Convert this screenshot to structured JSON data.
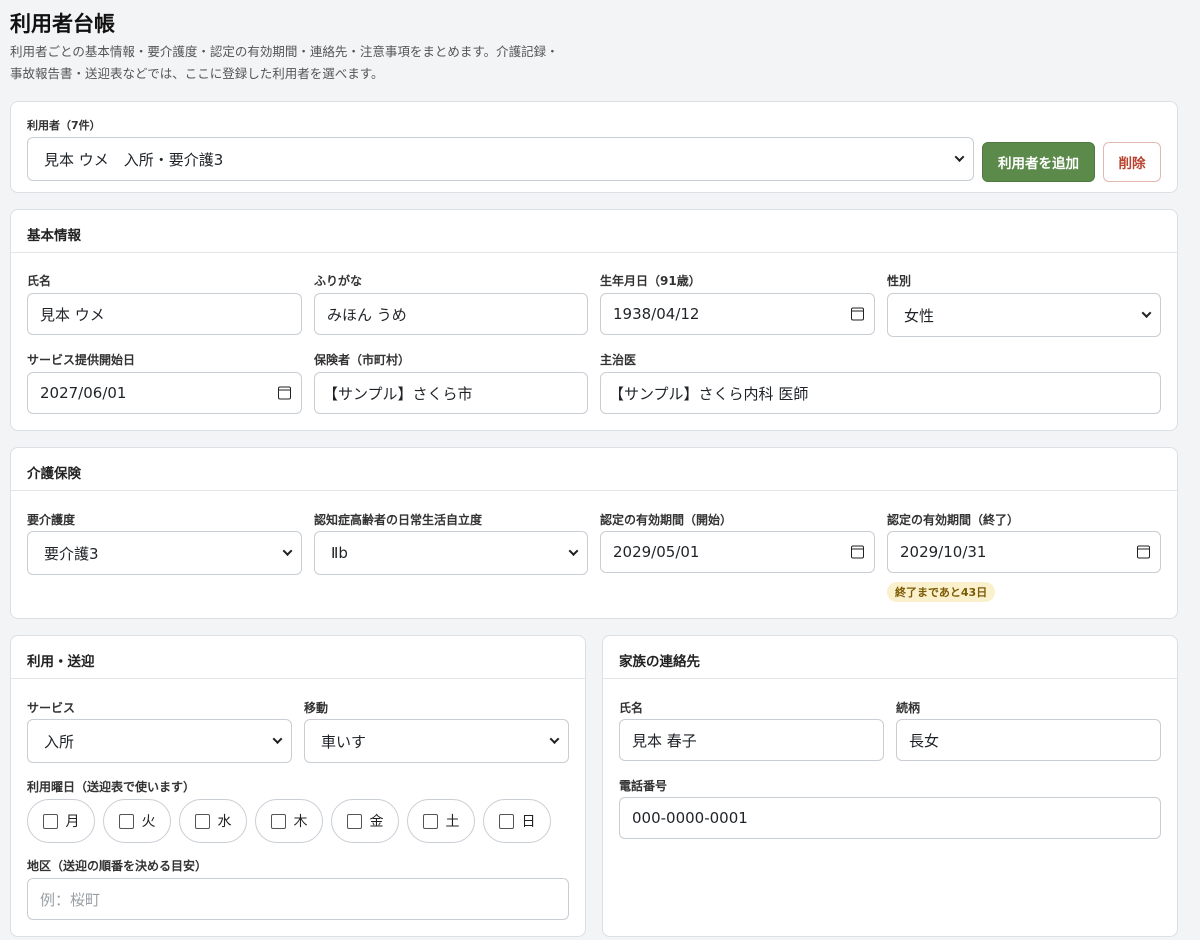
{
  "page": {
    "title": "利用者台帳",
    "description": "利用者ごとの基本情報・要介護度・認定の有効期間・連絡先・注意事項をまとめます。介護記録・事故報告書・送迎表などでは、ここに登録した利用者を選べます。"
  },
  "selector": {
    "label": "利用者（7件）",
    "selected": "見本 ウメ　入所・要介護3",
    "add_button": "利用者を追加",
    "delete_button": "削除"
  },
  "basic": {
    "heading": "基本情報",
    "name_label": "氏名",
    "name_value": "見本 ウメ",
    "kana_label": "ふりがな",
    "kana_value": "みほん うめ",
    "birth_label": "生年月日（91歳）",
    "birth_value": "1938/04/12",
    "gender_label": "性別",
    "gender_value": "女性",
    "start_label": "サービス提供開始日",
    "start_value": "2027/06/01",
    "insurer_label": "保険者（市町村）",
    "insurer_value": "【サンプル】さくら市",
    "doctor_label": "主治医",
    "doctor_value": "【サンプル】さくら内科 医師"
  },
  "insurance": {
    "heading": "介護保険",
    "care_level_label": "要介護度",
    "care_level_value": "要介護3",
    "dementia_label": "認知症高齢者の日常生活自立度",
    "dementia_value": "Ⅱb",
    "period_start_label": "認定の有効期間（開始）",
    "period_start_value": "2029/05/01",
    "period_end_label": "認定の有効期間（終了）",
    "period_end_value": "2029/10/31",
    "remaining_badge": "終了まであと43日"
  },
  "usage": {
    "heading": "利用・送迎",
    "service_label": "サービス",
    "service_value": "入所",
    "mobility_label": "移動",
    "mobility_value": "車いす",
    "days_label": "利用曜日（送迎表で使います）",
    "days": [
      "月",
      "火",
      "水",
      "木",
      "金",
      "土",
      "日"
    ],
    "area_label": "地区（送迎の順番を決める目安）",
    "area_placeholder": "例：桜町"
  },
  "family": {
    "heading": "家族の連絡先",
    "name_label": "氏名",
    "name_value": "見本 春子",
    "relation_label": "続柄",
    "relation_value": "長女",
    "phone_label": "電話番号",
    "phone_value": "000-0000-0001"
  },
  "colors": {
    "add_button": "#5b8a4a",
    "delete_text": "#b8432f",
    "badge_bg": "#fbf0cc"
  }
}
